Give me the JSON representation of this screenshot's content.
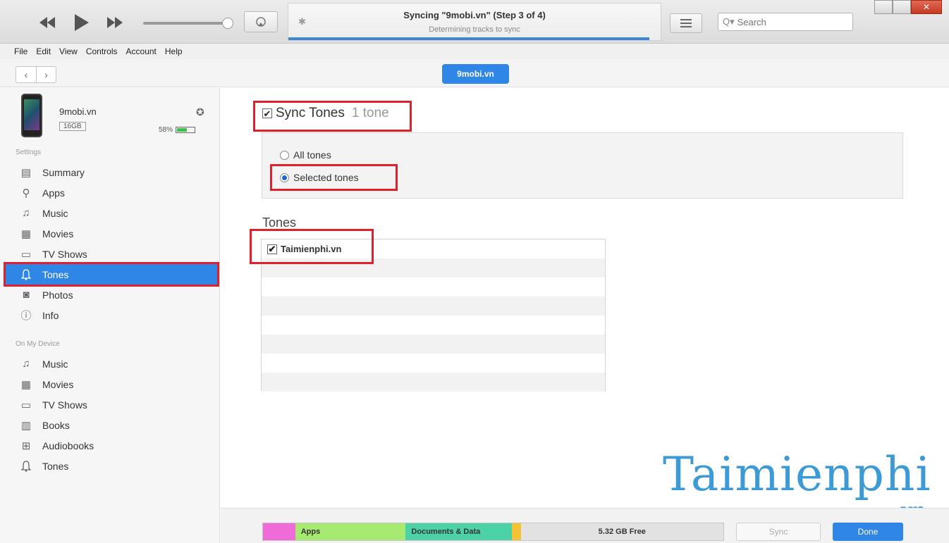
{
  "player": {
    "now_syncing_title": "Syncing \"9mobi.vn\" (Step 3 of 4)",
    "now_syncing_sub": "Determining tracks to sync",
    "progress_fraction": 0.97,
    "search_placeholder": "Search",
    "search_prefix": "Q▾"
  },
  "menu": [
    "File",
    "Edit",
    "View",
    "Controls",
    "Account",
    "Help"
  ],
  "device_button": "9mobi.vn",
  "device": {
    "name": "9mobi.vn",
    "capacity": "16GB",
    "battery": "58%",
    "battery_fraction": 0.58
  },
  "sidebar": {
    "settings_label": "Settings",
    "settings_items": [
      {
        "label": "Summary",
        "icon": "summary-icon"
      },
      {
        "label": "Apps",
        "icon": "apps-icon"
      },
      {
        "label": "Music",
        "icon": "music-icon"
      },
      {
        "label": "Movies",
        "icon": "movies-icon"
      },
      {
        "label": "TV Shows",
        "icon": "tv-icon"
      },
      {
        "label": "Tones",
        "icon": "bell-icon",
        "selected": true
      },
      {
        "label": "Photos",
        "icon": "camera-icon"
      },
      {
        "label": "Info",
        "icon": "info-icon"
      }
    ],
    "device_label": "On My Device",
    "device_items": [
      {
        "label": "Music",
        "icon": "music-icon"
      },
      {
        "label": "Movies",
        "icon": "movies-icon"
      },
      {
        "label": "TV Shows",
        "icon": "tv-icon"
      },
      {
        "label": "Books",
        "icon": "books-icon"
      },
      {
        "label": "Audiobooks",
        "icon": "audiobook-icon"
      },
      {
        "label": "Tones",
        "icon": "bell-icon"
      }
    ]
  },
  "main": {
    "sync_label": "Sync Tones",
    "sync_count": "1 tone",
    "option_all": "All tones",
    "option_selected": "Selected tones",
    "tones_heading": "Tones",
    "tones": [
      "Taimienphi.vn"
    ]
  },
  "watermark": {
    "main": "Taimienphi",
    "sub": ".vn"
  },
  "capacity": {
    "segments": [
      {
        "label": "",
        "color": "#f06bd8",
        "fraction": 0.07
      },
      {
        "label": "Apps",
        "color": "#a6ea72",
        "fraction": 0.24
      },
      {
        "label": "Documents & Data",
        "color": "#4dd1a6",
        "fraction": 0.23
      },
      {
        "label": "",
        "color": "#f2c433",
        "fraction": 0.02
      },
      {
        "label": "5.32 GB Free",
        "color": "#e2e2e2",
        "fraction": 0.44
      }
    ]
  },
  "buttons": {
    "sync": "Sync",
    "done": "Done"
  },
  "colors": {
    "accent": "#2f86e6",
    "highlight_box": "#e0202a"
  }
}
